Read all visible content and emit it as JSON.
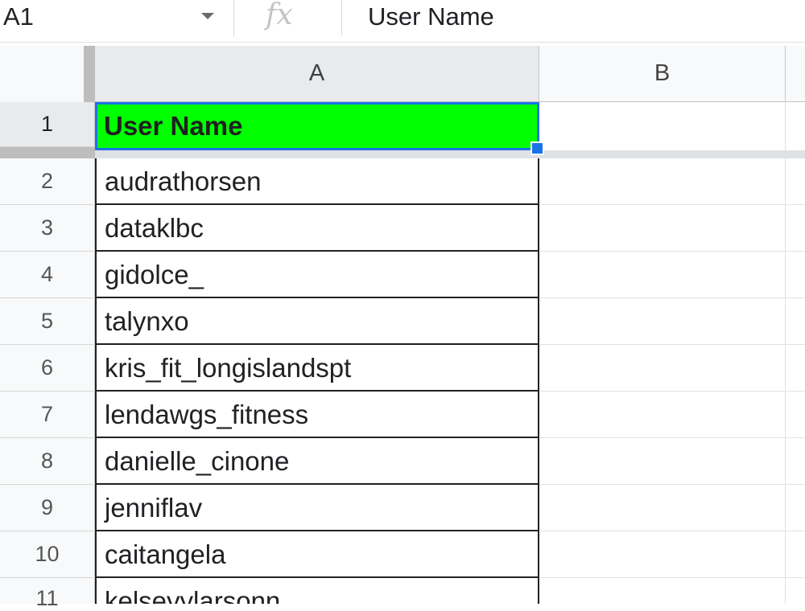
{
  "formula_bar": {
    "name_box": "A1",
    "fx_icon": "fx",
    "value": "User Name"
  },
  "columns": [
    "A",
    "B"
  ],
  "rows": [
    {
      "num": "1",
      "a": "User Name"
    },
    {
      "num": "2",
      "a": "audrathorsen"
    },
    {
      "num": "3",
      "a": "dataklbc"
    },
    {
      "num": "4",
      "a": "gidolce_"
    },
    {
      "num": "5",
      "a": "talynxo"
    },
    {
      "num": "6",
      "a": "kris_fit_longislandspt"
    },
    {
      "num": "7",
      "a": "lendawgs_fitness"
    },
    {
      "num": "8",
      "a": "danielle_cinone"
    },
    {
      "num": "9",
      "a": "jenniflav"
    },
    {
      "num": "10",
      "a": "caitangela"
    },
    {
      "num": "11",
      "a": "kelseyylarsonn"
    }
  ],
  "colors": {
    "header_fill": "#00ff00",
    "selection": "#1a73e8"
  }
}
